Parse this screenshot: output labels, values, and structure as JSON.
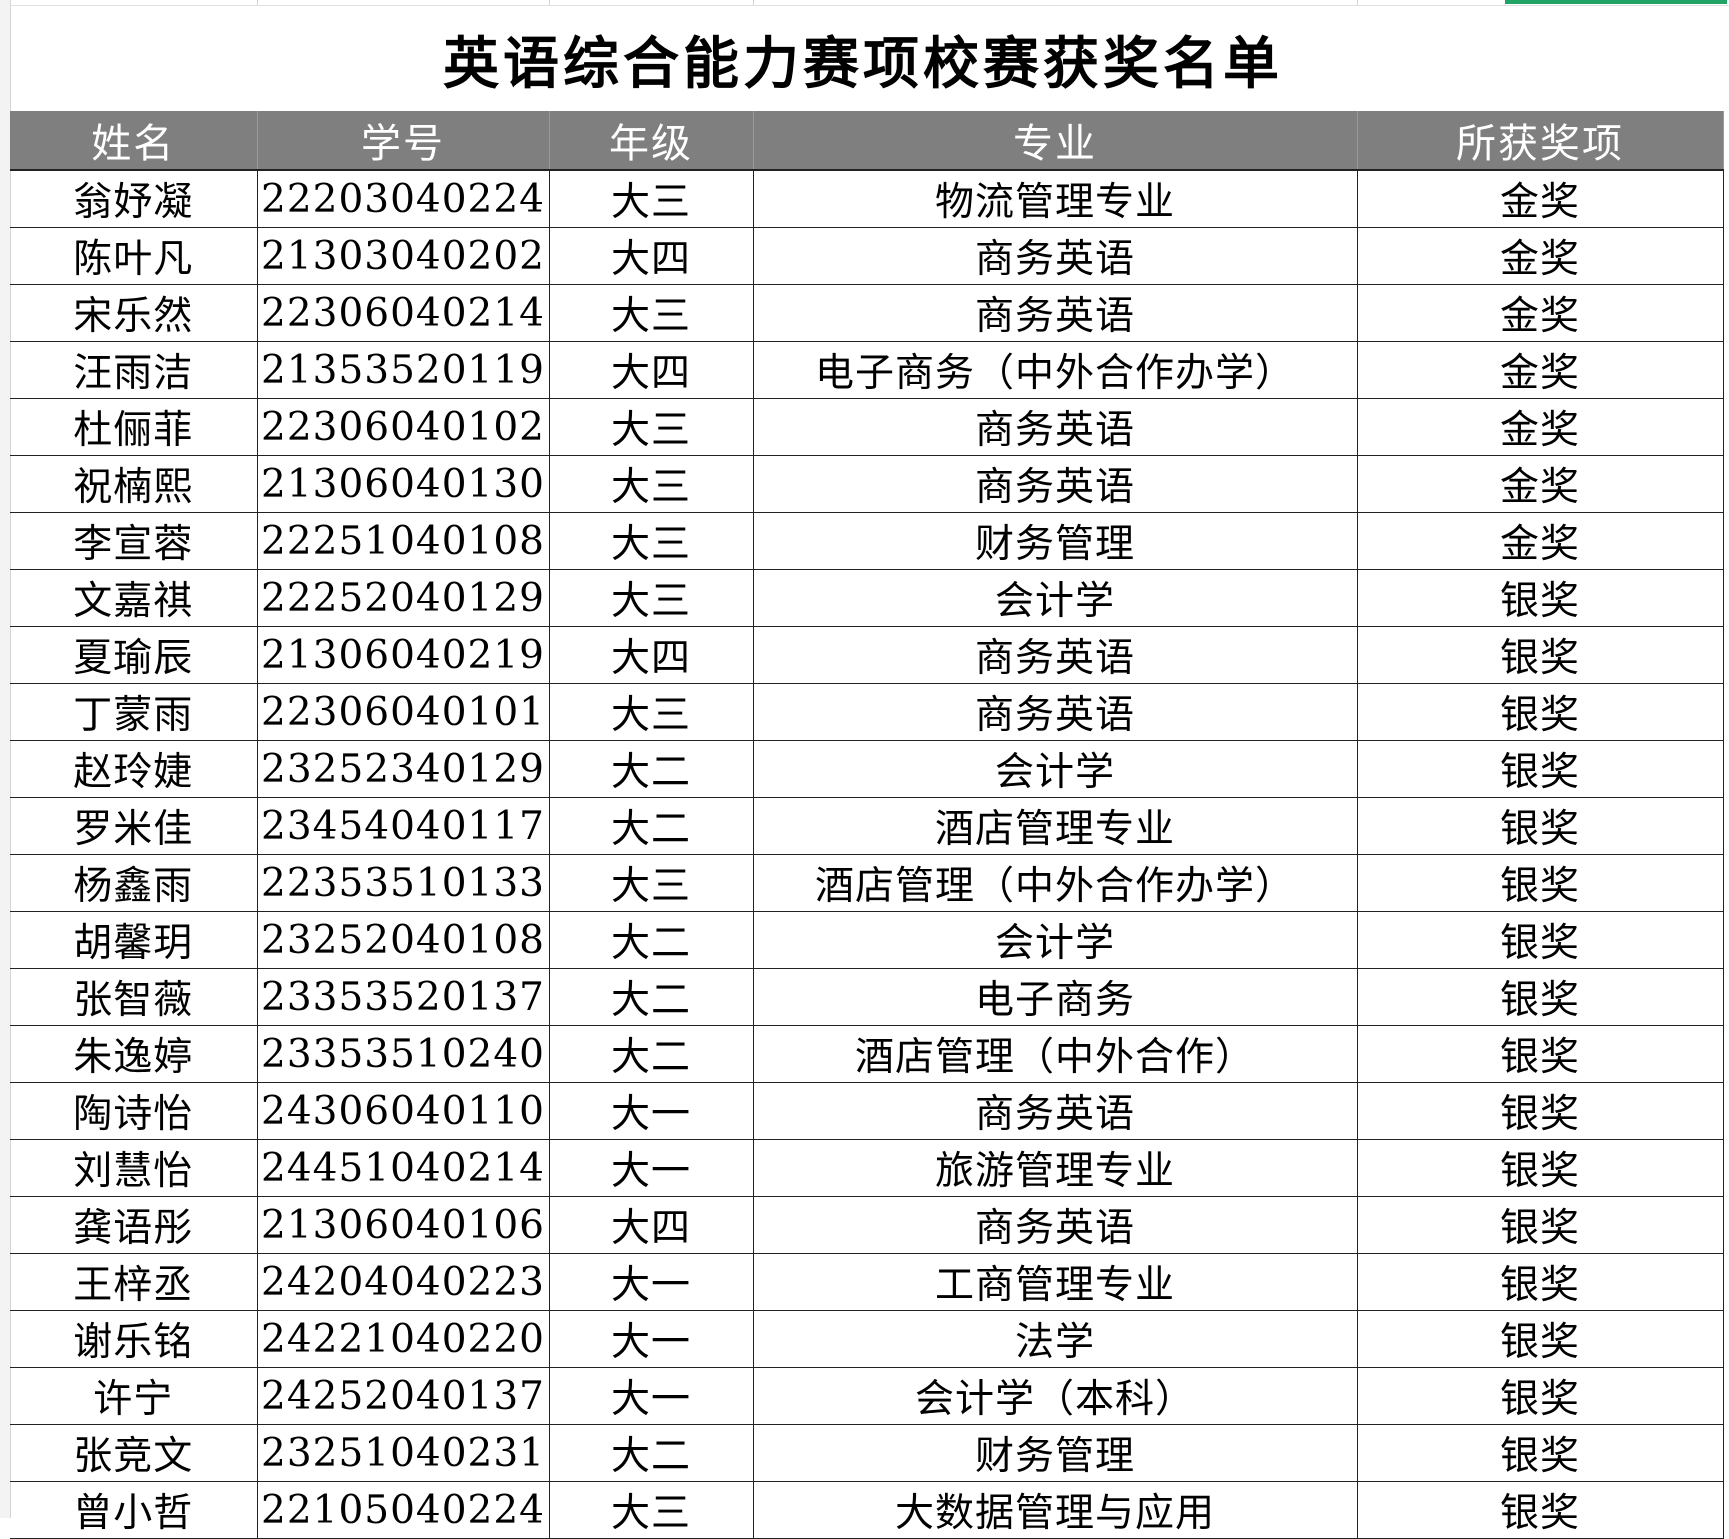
{
  "title": "英语综合能力赛项校赛获奖名单",
  "columns": [
    "姓名",
    "学号",
    "年级",
    "专业",
    "所获奖项"
  ],
  "rows": [
    [
      "翁妤凝",
      "22203040224",
      "大三",
      "物流管理专业",
      "金奖"
    ],
    [
      "陈叶凡",
      "21303040202",
      "大四",
      "商务英语",
      "金奖"
    ],
    [
      "宋乐然",
      "22306040214",
      "大三",
      "商务英语",
      "金奖"
    ],
    [
      "汪雨洁",
      "21353520119",
      "大四",
      "电子商务（中外合作办学）",
      "金奖"
    ],
    [
      "杜俪菲",
      "22306040102",
      "大三",
      "商务英语",
      "金奖"
    ],
    [
      "祝楠熙",
      "21306040130",
      "大三",
      "商务英语",
      "金奖"
    ],
    [
      "李宣蓉",
      "22251040108",
      "大三",
      "财务管理",
      "金奖"
    ],
    [
      "文嘉祺",
      "22252040129",
      "大三",
      "会计学",
      "银奖"
    ],
    [
      "夏瑜辰",
      "21306040219",
      "大四",
      "商务英语",
      "银奖"
    ],
    [
      "丁蒙雨",
      "22306040101",
      "大三",
      "商务英语",
      "银奖"
    ],
    [
      "赵玲婕",
      "23252340129",
      "大二",
      "会计学",
      "银奖"
    ],
    [
      "罗米佳",
      "23454040117",
      "大二",
      "酒店管理专业",
      "银奖"
    ],
    [
      "杨鑫雨",
      "22353510133",
      "大三",
      "酒店管理（中外合作办学）",
      "银奖"
    ],
    [
      "胡馨玥",
      "23252040108",
      "大二",
      "会计学",
      "银奖"
    ],
    [
      "张智薇",
      "23353520137",
      "大二",
      "电子商务",
      "银奖"
    ],
    [
      "朱逸婷",
      "23353510240",
      "大二",
      "酒店管理（中外合作）",
      "银奖"
    ],
    [
      "陶诗怡",
      "24306040110",
      "大一",
      "商务英语",
      "银奖"
    ],
    [
      "刘慧怡",
      "24451040214",
      "大一",
      "旅游管理专业",
      "银奖"
    ],
    [
      "龚语彤",
      "21306040106",
      "大四",
      "商务英语",
      "银奖"
    ],
    [
      "王梓丞",
      "24204040223",
      "大一",
      "工商管理专业",
      "银奖"
    ],
    [
      "谢乐铭",
      "24221040220",
      "大一",
      "法学",
      "银奖"
    ],
    [
      "许宁",
      "24252040137",
      "大一",
      "会计学（本科）",
      "银奖"
    ],
    [
      "张竞文",
      "23251040231",
      "大二",
      "财务管理",
      "银奖"
    ],
    [
      "曾小哲",
      "22105040224",
      "大三",
      "大数据管理与应用",
      "银奖"
    ]
  ],
  "colors": {
    "header_bg": "#7f7f7f",
    "header_text": "#ffffff",
    "active_tab": "#21a366"
  }
}
